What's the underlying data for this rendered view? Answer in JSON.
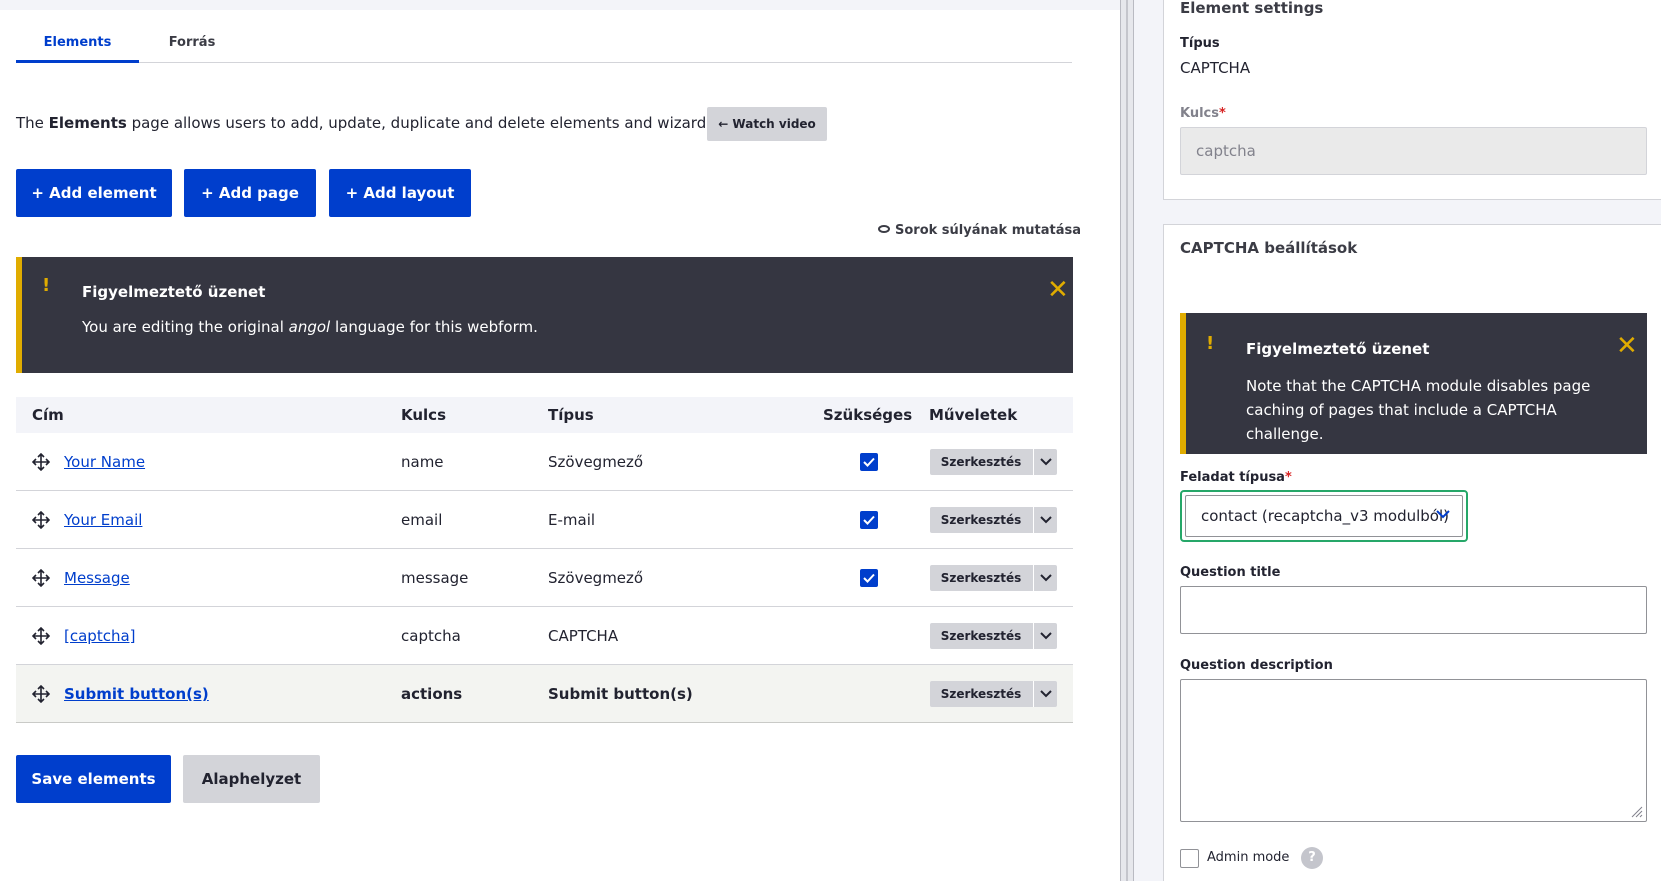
{
  "tabs": [
    {
      "label": "Elements",
      "active": true
    },
    {
      "label": "Forrás",
      "active": false
    }
  ],
  "intro": {
    "prefix": "The ",
    "bold": "Elements",
    "suffix": " page allows users to add, update, duplicate and delete elements and wizard pages.",
    "watch_label": "← Watch video"
  },
  "actions": {
    "add_element": "+ Add element",
    "add_page": "+ Add page",
    "add_layout": "+ Add layout",
    "show_weights": "Sorok súlyának mutatása"
  },
  "warning_left": {
    "icon": "!",
    "title": "Figyelmeztető üzenet",
    "body_prefix": "You are editing the original ",
    "body_em": "angol",
    "body_suffix": " language for this webform."
  },
  "table": {
    "headers": {
      "title": "Cím",
      "key": "Kulcs",
      "type": "Típus",
      "required": "Szükséges",
      "operations": "Műveletek"
    },
    "edit_label": "Szerkesztés",
    "rows": [
      {
        "title": "Your Name",
        "key": "name",
        "type": "Szövegmező",
        "required": true
      },
      {
        "title": "Your Email",
        "key": "email",
        "type": "E-mail",
        "required": true
      },
      {
        "title": "Message",
        "key": "message",
        "type": "Szövegmező",
        "required": true
      },
      {
        "title": "[captcha]",
        "key": "captcha",
        "type": "CAPTCHA",
        "required": false
      },
      {
        "title": "Submit button(s)",
        "key": "actions",
        "type": "Submit button(s)",
        "required": false
      }
    ]
  },
  "footer": {
    "save_label": "Save elements",
    "reset_label": "Alaphelyzet"
  },
  "sidebar": {
    "settings_title": "Element settings",
    "type_label": "Típus",
    "type_value": "CAPTCHA",
    "key_label": "Kulcs",
    "key_required_mark": "*",
    "key_value": "captcha",
    "captcha_title": "CAPTCHA beállítások",
    "warning": {
      "icon": "!",
      "title": "Figyelmeztető üzenet",
      "body": "Note that the CAPTCHA module disables page caching of pages that include a CAPTCHA challenge."
    },
    "challenge_label": "Feladat típusa",
    "challenge_required_mark": "*",
    "challenge_value": "contact (recaptcha_v3 modulból)",
    "question_title_label": "Question title",
    "question_title_value": "",
    "question_desc_label": "Question description",
    "question_desc_value": "",
    "admin_mode_label": "Admin mode",
    "help_icon": "?"
  },
  "colors": {
    "primary": "#003ecc",
    "warning_bg": "#353641",
    "warning_accent": "#e0ac00",
    "focus": "#26a769",
    "required": "#d72222"
  }
}
